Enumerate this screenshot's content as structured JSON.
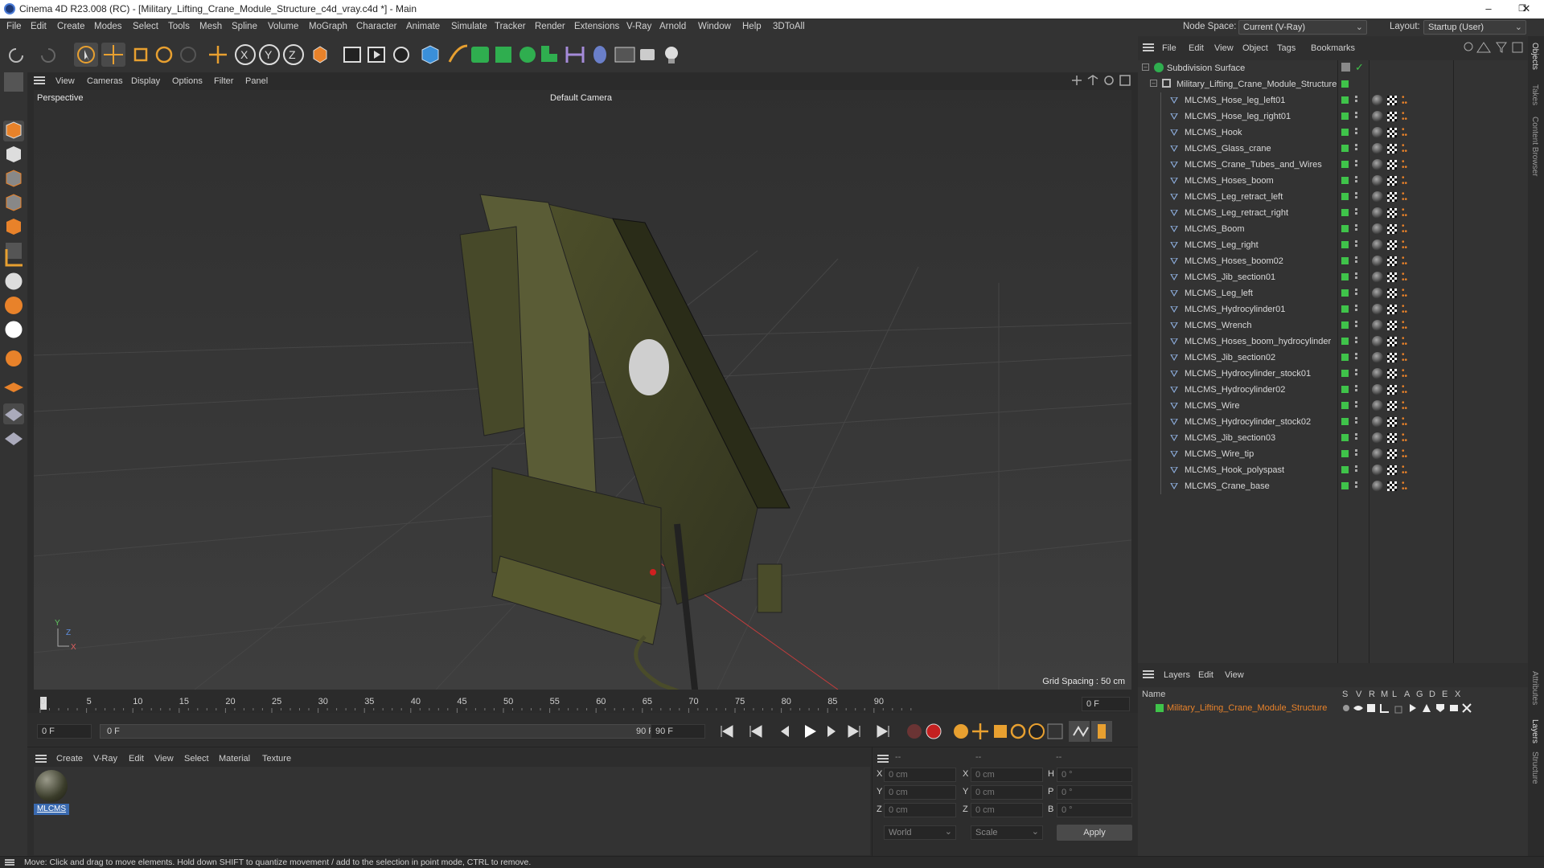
{
  "window": {
    "title": "Cinema 4D R23.008 (RC) - [Military_Lifting_Crane_Module_Structure_c4d_vray.c4d *] - Main",
    "minimize": "–",
    "maximize": "❐",
    "close": "✕"
  },
  "menu": [
    "File",
    "Edit",
    "Create",
    "Modes",
    "Select",
    "Tools",
    "Mesh",
    "Spline",
    "Volume",
    "MoGraph",
    "Character",
    "Animate",
    "Simulate",
    "Tracker",
    "Render",
    "Extensions",
    "V-Ray",
    "Arnold",
    "Window",
    "Help",
    "3DToAll"
  ],
  "node_space": {
    "label": "Node Space:",
    "value": "Current (V-Ray)"
  },
  "layout": {
    "label": "Layout:",
    "value": "Startup (User)"
  },
  "viewport": {
    "menu": [
      "View",
      "Cameras",
      "Display",
      "Options",
      "Filter",
      "Panel"
    ],
    "name": "Perspective",
    "camera": "Default Camera",
    "grid_spacing": "Grid Spacing : 50 cm"
  },
  "object_manager": {
    "menu": [
      "File",
      "Edit",
      "View",
      "Object",
      "Tags",
      "Bookmarks"
    ],
    "root": "Subdivision Surface",
    "group": "Military_Lifting_Crane_Module_Structure",
    "objects": [
      "MLCMS_Hose_leg_left01",
      "MLCMS_Hose_leg_right01",
      "MLCMS_Hook",
      "MLCMS_Glass_crane",
      "MLCMS_Crane_Tubes_and_Wires",
      "MLCMS_Hoses_boom",
      "MLCMS_Leg_retract_left",
      "MLCMS_Leg_retract_right",
      "MLCMS_Boom",
      "MLCMS_Leg_right",
      "MLCMS_Hoses_boom02",
      "MLCMS_Jib_section01",
      "MLCMS_Leg_left",
      "MLCMS_Hydrocylinder01",
      "MLCMS_Wrench",
      "MLCMS_Hoses_boom_hydrocylinder",
      "MLCMS_Jib_section02",
      "MLCMS_Hydrocylinder_stock01",
      "MLCMS_Hydrocylinder02",
      "MLCMS_Wire",
      "MLCMS_Hydrocylinder_stock02",
      "MLCMS_Jib_section03",
      "MLCMS_Wire_tip",
      "MLCMS_Hook_polyspast",
      "MLCMS_Crane_base"
    ]
  },
  "right_tabs": [
    "Objects",
    "Takes",
    "Content Browser",
    "Attributes",
    "Layers",
    "Structure"
  ],
  "layers": {
    "menu": [
      "Layers",
      "Edit",
      "View"
    ],
    "header_name": "Name",
    "header_cols": [
      "S",
      "V",
      "R",
      "M",
      "L",
      "A",
      "G",
      "D",
      "E",
      "X"
    ],
    "layer_name": "Military_Lifting_Crane_Module_Structure"
  },
  "timeline": {
    "ticks": [
      "0",
      "5",
      "10",
      "15",
      "20",
      "25",
      "30",
      "35",
      "40",
      "45",
      "50",
      "55",
      "60",
      "65",
      "70",
      "75",
      "80",
      "85",
      "90"
    ],
    "current_frame": "0 F",
    "start": "0 F",
    "range_start": "0 F",
    "range_end": "90 F",
    "end": "90 F"
  },
  "material_manager": {
    "menu": [
      "Create",
      "V-Ray",
      "Edit",
      "View",
      "Select",
      "Material",
      "Texture"
    ],
    "material_name": "MLCMS"
  },
  "coordinates": {
    "header": [
      "--",
      "--",
      "--"
    ],
    "rows": [
      {
        "a": "X",
        "pos": "0 cm",
        "b": "X",
        "size": "0 cm",
        "c": "H",
        "rot": "0 °"
      },
      {
        "a": "Y",
        "pos": "0 cm",
        "b": "Y",
        "size": "0 cm",
        "c": "P",
        "rot": "0 °"
      },
      {
        "a": "Z",
        "pos": "0 cm",
        "b": "Z",
        "size": "0 cm",
        "c": "B",
        "rot": "0 °"
      }
    ],
    "space": "World",
    "mode": "Scale",
    "apply": "Apply"
  },
  "status": "Move: Click and drag to move elements. Hold down SHIFT to quantize movement / add to the selection in point mode, CTRL to remove.",
  "colors": {
    "accent_orange": "#e8822a",
    "visible_green": "#3fc34a",
    "bg": "#2d2d2d"
  }
}
